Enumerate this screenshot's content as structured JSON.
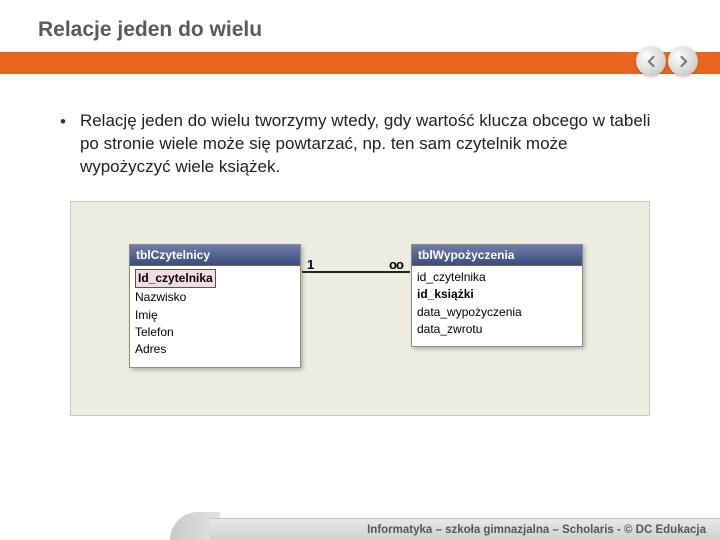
{
  "slide": {
    "title": "Relacje jeden do wielu",
    "bullet": "Relację jeden do wielu tworzymy wtedy, gdy wartość klucza obcego w tabeli po stronie wiele może się powtarzać, np. ten sam czytelnik może wypożyczyć wiele książek."
  },
  "diagram": {
    "left_table": {
      "title": "tblCzytelnicy",
      "pk": "Id_czytelnika",
      "fields": [
        "Nazwisko",
        "Imię",
        "Telefon",
        "Adres"
      ]
    },
    "right_table": {
      "title": "tblWypożyczenia",
      "fields": [
        {
          "text": "id_czytelnika",
          "bold": false
        },
        {
          "text": "id_książki",
          "bold": true
        },
        {
          "text": "data_wypożyczenia",
          "bold": false
        },
        {
          "text": "data_zwrotu",
          "bold": false
        }
      ]
    },
    "cardinality": {
      "one": "1",
      "many": "oo"
    }
  },
  "footer": {
    "text": "Informatyka – szkoła gimnazjalna – Scholaris - © DC Edukacja"
  },
  "nav": {
    "prev": "prev",
    "next": "next"
  }
}
